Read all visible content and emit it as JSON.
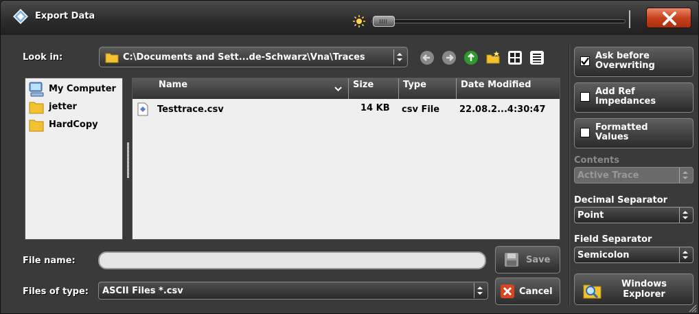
{
  "window": {
    "title": "Export Data"
  },
  "look_in": {
    "label": "Look in:",
    "path": "C:\\Documents and Sett...de-Schwarz\\Vna\\Traces"
  },
  "sidebar": {
    "items": [
      {
        "label": "My Computer",
        "icon": "computer-icon"
      },
      {
        "label": "jetter",
        "icon": "folder-icon"
      },
      {
        "label": "HardCopy",
        "icon": "folder-icon"
      }
    ]
  },
  "filelist": {
    "columns": [
      "Name",
      "Size",
      "Type",
      "Date Modified"
    ],
    "rows": [
      {
        "name": "Testtrace.csv",
        "size": "14 KB",
        "type": "csv File",
        "date": "22.08.2...4:30:47"
      }
    ]
  },
  "file_name": {
    "label": "File name:",
    "value": ""
  },
  "file_type": {
    "label": "Files of type:",
    "value": "ASCII Files *.csv"
  },
  "buttons": {
    "save": "Save",
    "cancel": "Cancel"
  },
  "options": {
    "ask_before_overwriting": {
      "line1": "Ask before",
      "line2": "Overwriting",
      "checked": true
    },
    "add_ref_impedances": {
      "line1": "Add Ref",
      "line2": "Impedances",
      "checked": false
    },
    "formatted_values": {
      "line1": "Formatted",
      "line2": "Values",
      "checked": false
    },
    "contents": {
      "label": "Contents",
      "value": "Active Trace",
      "enabled": false
    },
    "decimal_separator": {
      "label": "Decimal Separator",
      "value": "Point"
    },
    "field_separator": {
      "label": "Field Separator",
      "value": "Semicolon"
    },
    "explorer": {
      "line1": "Windows",
      "line2": "Explorer"
    }
  },
  "colors": {
    "close": "#c7421e",
    "folder": "#f2c230",
    "panel": "#3a3a3a"
  }
}
